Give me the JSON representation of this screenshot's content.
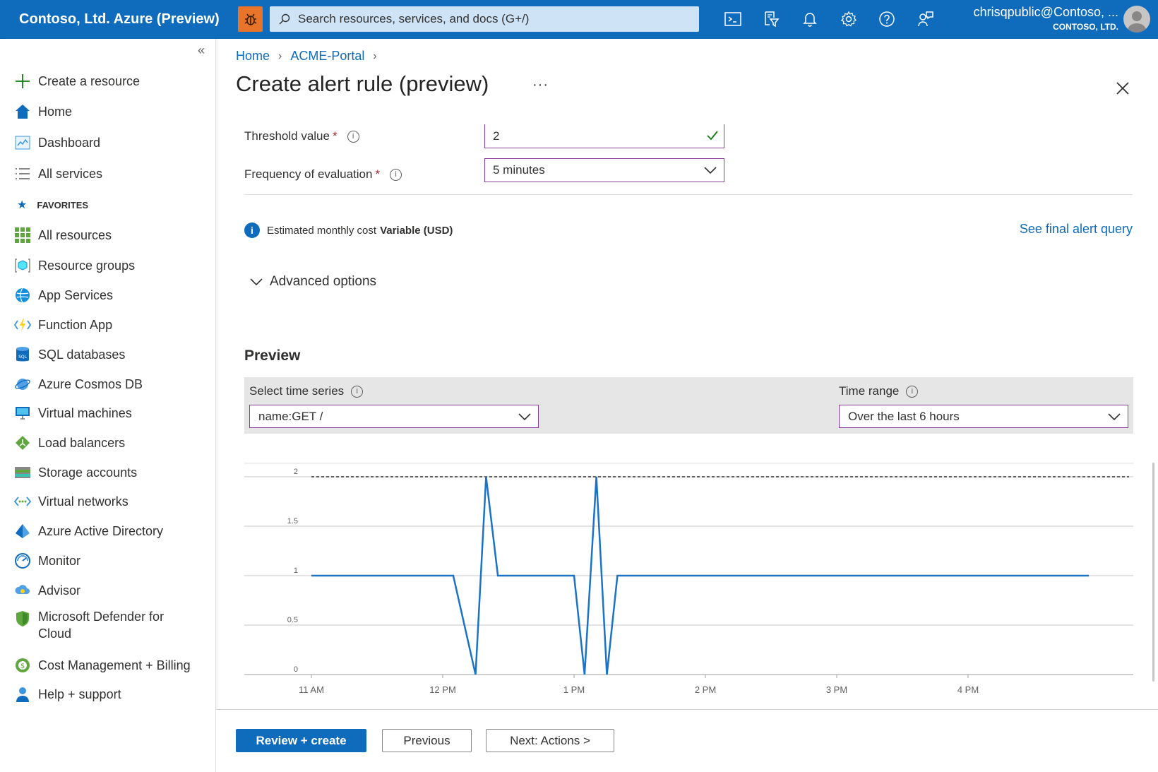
{
  "topbar": {
    "brand": "Contoso, Ltd. Azure (Preview)",
    "search_placeholder": "Search resources, services, and docs (G+/)",
    "account_email": "chrisqpublic@Contoso, ...",
    "account_tenant": "CONTOSO, LTD."
  },
  "sidebar": {
    "create": "Create a resource",
    "home": "Home",
    "dashboard": "Dashboard",
    "all_services": "All services",
    "favorites_label": "FAVORITES",
    "items": [
      {
        "label": "All resources",
        "icon": "grid-icon"
      },
      {
        "label": "Resource groups",
        "icon": "resource-group-icon"
      },
      {
        "label": "App Services",
        "icon": "globe-icon"
      },
      {
        "label": "Function App",
        "icon": "lightning-icon"
      },
      {
        "label": "SQL databases",
        "icon": "sql-icon"
      },
      {
        "label": "Azure Cosmos DB",
        "icon": "planet-icon"
      },
      {
        "label": "Virtual machines",
        "icon": "monitor-icon"
      },
      {
        "label": "Load balancers",
        "icon": "diamond-icon"
      },
      {
        "label": "Storage accounts",
        "icon": "storage-icon"
      },
      {
        "label": "Virtual networks",
        "icon": "network-icon"
      },
      {
        "label": "Azure Active Directory",
        "icon": "pyramid-icon"
      },
      {
        "label": "Monitor",
        "icon": "gauge-icon"
      },
      {
        "label": "Advisor",
        "icon": "cloud-icon"
      },
      {
        "label": "Microsoft Defender for Cloud",
        "icon": "shield-icon"
      },
      {
        "label": "Cost Management + Billing",
        "icon": "coin-icon"
      },
      {
        "label": "Help + support",
        "icon": "person-icon"
      }
    ]
  },
  "breadcrumb": {
    "home": "Home",
    "portal": "ACME-Portal"
  },
  "page": {
    "title": "Create alert rule (preview)",
    "more": "···"
  },
  "form": {
    "threshold_label": "Threshold value",
    "threshold_value": "2",
    "frequency_label": "Frequency of evaluation",
    "frequency_value": "5 minutes",
    "required_mark": "*",
    "cost_prefix": "Estimated monthly cost",
    "cost_value": "Variable (USD)",
    "see_query": "See final alert query",
    "advanced": "Advanced options"
  },
  "preview": {
    "title": "Preview",
    "series_label": "Select time series",
    "series_value": "name:GET /",
    "range_label": "Time range",
    "range_value": "Over the last 6 hours"
  },
  "chart_data": {
    "type": "line",
    "x_ticks": [
      "11 AM",
      "12 PM",
      "1 PM",
      "2 PM",
      "3 PM",
      "4 PM"
    ],
    "y_ticks": [
      "0",
      "0.5",
      "1",
      "1.5",
      "2"
    ],
    "ylim": [
      0,
      2
    ],
    "threshold": 2,
    "series_color": "#1a73c7",
    "series": [
      {
        "x_hours": [
          11.0,
          12.08,
          12.25,
          12.33,
          12.42,
          13.0,
          13.08,
          13.17,
          13.25,
          13.33,
          13.42,
          16.92
        ],
        "values": [
          1,
          1,
          0,
          2,
          1,
          1,
          0,
          2,
          0,
          1,
          1,
          1
        ]
      }
    ]
  },
  "footer": {
    "review": "Review + create",
    "previous": "Previous",
    "next": "Next: Actions >"
  }
}
